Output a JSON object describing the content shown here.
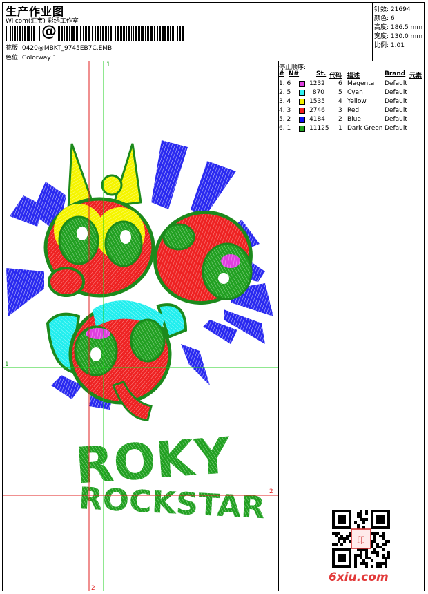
{
  "header": {
    "title": "生产作业图",
    "company": "Wilcom(汇宝) 彩绣工作室",
    "barcode_symbol": "@",
    "design_label": "花版:",
    "design_value": "0420@MBKT_9745EB7C.EMB",
    "colorway_label": "色位:",
    "colorway_value": "Colorway 1"
  },
  "stats": [
    {
      "label": "针数:",
      "value": "21694"
    },
    {
      "label": "颜色:",
      "value": "6"
    },
    {
      "label": "高度:",
      "value": "186.5 mm"
    },
    {
      "label": "宽度:",
      "value": "130.0 mm"
    },
    {
      "label": "比例:",
      "value": "1.01"
    }
  ],
  "sequence": {
    "title": "停止顺序:",
    "columns": [
      "#",
      "N#",
      "St.",
      "代码",
      "描述",
      "Brand",
      "元素"
    ],
    "rows": [
      {
        "idx": "1. 6",
        "color": "#e040e0",
        "st": "1232",
        "code": "6",
        "desc": "Magenta",
        "brand": "Default"
      },
      {
        "idx": "2. 5",
        "color": "#30f0f0",
        "st": "870",
        "code": "5",
        "desc": "Cyan",
        "brand": "Default"
      },
      {
        "idx": "3. 4",
        "color": "#f0f000",
        "st": "1535",
        "code": "4",
        "desc": "Yellow",
        "brand": "Default"
      },
      {
        "idx": "4. 3",
        "color": "#f02020",
        "st": "2746",
        "code": "3",
        "desc": "Red",
        "brand": "Default"
      },
      {
        "idx": "5. 2",
        "color": "#1010f0",
        "st": "4184",
        "code": "2",
        "desc": "Blue",
        "brand": "Default"
      },
      {
        "idx": "6. 1",
        "color": "#20a020",
        "st": "11125",
        "code": "1",
        "desc": "Dark Green",
        "brand": "Default"
      }
    ]
  },
  "canvas": {
    "guide_v1": "1",
    "guide_v2": "2",
    "guide_h1": "1",
    "guide_h2": "2",
    "line1": "ROKY",
    "line2": "ROCKSTAR"
  },
  "watermark": "6xiu.com"
}
